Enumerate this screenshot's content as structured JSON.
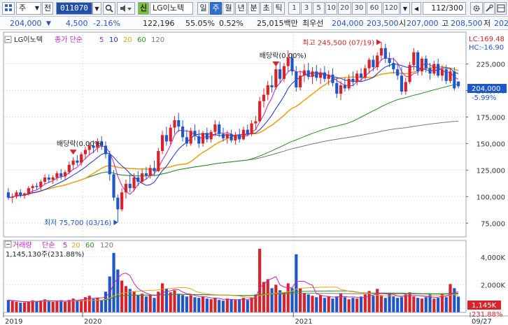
{
  "toolbar": {
    "market_label": "주",
    "period_label": "전",
    "stock_code": "011070",
    "badge": "신",
    "stock_name": "LG이노텍",
    "periods": [
      "일",
      "주",
      "월",
      "년",
      "분",
      "초",
      "틱"
    ],
    "active_period": "주",
    "intervals": [
      "1",
      "3",
      "5",
      "10",
      "20",
      "30",
      "60",
      "120"
    ],
    "count_display": "112/300"
  },
  "quote": {
    "price": "204,000",
    "change": "4,500",
    "change_pct": "-2.16%",
    "volume": "122,196",
    "volume_ratio": "55.05%",
    "turnover_ratio": "0.52%",
    "trade_value": "25,015백만",
    "bid_label": "최우선",
    "bid1": "204,000",
    "bid2": "203,500",
    "high_label": "시",
    "open": "207,000",
    "high_label2": "고",
    "high": "208,500",
    "low_label": "저",
    "low": "202"
  },
  "colors": {
    "up": "#d8232a",
    "down": "#1f57c8",
    "ma5": "#c021c0",
    "ma10": "#1b2fd0",
    "ma20": "#e8a317",
    "ma60": "#2a8f2a",
    "ma120": "#777777"
  },
  "chart_data": {
    "type": "candlestick",
    "price_legend": {
      "name": "LG이노텍",
      "label": "종가 단순",
      "periods": [
        "5",
        "10",
        "20",
        "60",
        "120"
      ]
    },
    "volume_legend": {
      "name": "거래량",
      "label": "단순",
      "periods": [
        "5",
        "20",
        "60",
        "120"
      ],
      "current": "1,145,130주(231.88%)"
    },
    "price_axis": {
      "ticks": [
        75000,
        100000,
        125000,
        150000,
        175000,
        200000,
        225000
      ],
      "tick_labels": [
        "75,000",
        "100,000",
        "125,000",
        "150,000",
        "175,000",
        "200,000",
        "225,000"
      ],
      "range": [
        62000,
        255000
      ]
    },
    "volume_axis": {
      "ticks": [
        2000,
        4000
      ],
      "tick_labels": [
        "2,000K",
        "4,000K"
      ],
      "range": [
        0,
        5200
      ]
    },
    "x_labels": [
      {
        "label": "2019",
        "index": 0
      },
      {
        "label": "2020",
        "index": 19
      },
      {
        "label": "2021",
        "index": 71
      },
      {
        "label": "09/27",
        "index": 111
      }
    ],
    "candles": [
      [
        104000,
        108000,
        97000,
        99000
      ],
      [
        99000,
        103000,
        94000,
        100000
      ],
      [
        100000,
        106000,
        98000,
        104000
      ],
      [
        104000,
        107000,
        99000,
        101000
      ],
      [
        101000,
        104000,
        98000,
        103000
      ],
      [
        103000,
        110000,
        101000,
        108000
      ],
      [
        108000,
        112000,
        104000,
        110000
      ],
      [
        110000,
        113000,
        106000,
        109000
      ],
      [
        109000,
        116000,
        106000,
        114000
      ],
      [
        114000,
        121000,
        111000,
        118000
      ],
      [
        118000,
        121000,
        113000,
        116000
      ],
      [
        116000,
        120000,
        112000,
        118000
      ],
      [
        118000,
        124000,
        115000,
        122000
      ],
      [
        122000,
        126000,
        116000,
        119000
      ],
      [
        119000,
        125000,
        116000,
        123000
      ],
      [
        123000,
        133000,
        121000,
        130000
      ],
      [
        130000,
        137000,
        126000,
        134000
      ],
      [
        134000,
        139000,
        129000,
        132000
      ],
      [
        132000,
        142000,
        129000,
        140000
      ],
      [
        140000,
        147000,
        135000,
        144000
      ],
      [
        144000,
        151000,
        139000,
        148000
      ],
      [
        148000,
        153000,
        141000,
        146000
      ],
      [
        146000,
        155000,
        142000,
        152000
      ],
      [
        152000,
        157000,
        144000,
        148000
      ],
      [
        148000,
        152000,
        136000,
        140000
      ],
      [
        140000,
        143000,
        115000,
        121000
      ],
      [
        121000,
        125000,
        96000,
        99000
      ],
      [
        99000,
        102000,
        75700,
        88000
      ],
      [
        88000,
        108000,
        86000,
        104000
      ],
      [
        104000,
        116000,
        98000,
        112000
      ],
      [
        112000,
        121000,
        104000,
        108000
      ],
      [
        108000,
        122000,
        105000,
        118000
      ],
      [
        118000,
        124000,
        110000,
        114000
      ],
      [
        114000,
        126000,
        112000,
        122000
      ],
      [
        122000,
        128000,
        116000,
        120000
      ],
      [
        120000,
        130000,
        117000,
        127000
      ],
      [
        127000,
        134000,
        120000,
        124000
      ],
      [
        124000,
        146000,
        123000,
        143000
      ],
      [
        143000,
        162000,
        140000,
        158000
      ],
      [
        158000,
        166000,
        148000,
        152000
      ],
      [
        152000,
        168000,
        149000,
        165000
      ],
      [
        165000,
        176000,
        159000,
        172000
      ],
      [
        172000,
        179000,
        161000,
        166000
      ],
      [
        166000,
        172000,
        152000,
        156000
      ],
      [
        156000,
        163000,
        147000,
        150000
      ],
      [
        150000,
        165000,
        148000,
        162000
      ],
      [
        162000,
        168000,
        153000,
        157000
      ],
      [
        157000,
        163000,
        146000,
        150000
      ],
      [
        150000,
        162000,
        147000,
        160000
      ],
      [
        160000,
        165000,
        151000,
        154000
      ],
      [
        154000,
        163000,
        151000,
        161000
      ],
      [
        161000,
        172000,
        157000,
        168000
      ],
      [
        168000,
        171000,
        156000,
        159000
      ],
      [
        159000,
        165000,
        152000,
        155000
      ],
      [
        155000,
        162000,
        150000,
        159000
      ],
      [
        159000,
        163000,
        151000,
        153000
      ],
      [
        153000,
        161000,
        149000,
        158000
      ],
      [
        158000,
        164000,
        151000,
        154000
      ],
      [
        154000,
        166000,
        153000,
        163000
      ],
      [
        163000,
        168000,
        157000,
        159000
      ],
      [
        159000,
        172000,
        157000,
        169000
      ],
      [
        169000,
        176000,
        163000,
        171000
      ],
      [
        171000,
        194000,
        170000,
        190000
      ],
      [
        190000,
        202000,
        184000,
        196000
      ],
      [
        196000,
        209000,
        191000,
        205000
      ],
      [
        205000,
        214000,
        198000,
        203000
      ],
      [
        203000,
        224000,
        201000,
        220000
      ],
      [
        220000,
        227000,
        207000,
        211000
      ],
      [
        211000,
        226000,
        208000,
        223000
      ],
      [
        223000,
        238000,
        218000,
        231000
      ],
      [
        231000,
        235000,
        214000,
        218000
      ],
      [
        218000,
        223000,
        199000,
        203000
      ],
      [
        203000,
        219000,
        200000,
        214000
      ],
      [
        214000,
        225000,
        208000,
        219000
      ],
      [
        219000,
        226000,
        210000,
        213000
      ],
      [
        213000,
        222000,
        206000,
        218000
      ],
      [
        218000,
        224000,
        209000,
        212000
      ],
      [
        212000,
        221000,
        206000,
        217000
      ],
      [
        217000,
        223000,
        208000,
        211000
      ],
      [
        211000,
        219000,
        205000,
        215000
      ],
      [
        215000,
        221000,
        204000,
        207000
      ],
      [
        207000,
        212000,
        193000,
        197000
      ],
      [
        197000,
        209000,
        191000,
        205000
      ],
      [
        205000,
        212000,
        199000,
        202000
      ],
      [
        202000,
        215000,
        200000,
        211000
      ],
      [
        211000,
        218000,
        204000,
        208000
      ],
      [
        208000,
        219000,
        205000,
        216000
      ],
      [
        216000,
        221000,
        208000,
        212000
      ],
      [
        212000,
        224000,
        210000,
        221000
      ],
      [
        221000,
        231000,
        216000,
        229000
      ],
      [
        229000,
        233000,
        218000,
        222000
      ],
      [
        222000,
        236000,
        219000,
        233000
      ],
      [
        233000,
        245500,
        228000,
        240000
      ],
      [
        240000,
        244000,
        226000,
        230000
      ],
      [
        230000,
        236000,
        222000,
        226000
      ],
      [
        226000,
        231000,
        216000,
        220000
      ],
      [
        220000,
        226000,
        210000,
        214000
      ],
      [
        214000,
        222000,
        196000,
        199000
      ],
      [
        199000,
        212000,
        196000,
        208000
      ],
      [
        208000,
        227000,
        206000,
        224000
      ],
      [
        224000,
        240000,
        219000,
        236000
      ],
      [
        236000,
        238000,
        214000,
        218000
      ],
      [
        218000,
        232000,
        214000,
        230000
      ],
      [
        230000,
        233000,
        217000,
        221000
      ],
      [
        221000,
        226000,
        210000,
        216000
      ],
      [
        216000,
        228000,
        214000,
        225000
      ],
      [
        225000,
        230000,
        212000,
        214000
      ],
      [
        214000,
        224000,
        209000,
        220000
      ],
      [
        220000,
        224000,
        206000,
        209000
      ],
      [
        209000,
        221000,
        207000,
        218000
      ],
      [
        218000,
        222000,
        200000,
        202000
      ],
      [
        208500,
        208500,
        202000,
        204000
      ]
    ],
    "volume": [
      900,
      820,
      760,
      700,
      720,
      780,
      880,
      820,
      860,
      940,
      800,
      760,
      820,
      880,
      760,
      900,
      1000,
      860,
      940,
      1100,
      1200,
      980,
      1050,
      900,
      1500,
      2600,
      4300,
      3100,
      2300,
      1900,
      1700,
      1500,
      1250,
      1350,
      1150,
      1250,
      1050,
      1500,
      2100,
      1700,
      1450,
      1600,
      1350,
      1250,
      1150,
      1250,
      1100,
      1050,
      1150,
      1000,
      950,
      1050,
      900,
      850,
      1000,
      950,
      900,
      950,
      1050,
      900,
      1100,
      1300,
      4600,
      2200,
      2400,
      1750,
      2000,
      1600,
      1450,
      2100,
      1750,
      4200,
      1750,
      1400,
      1300,
      1200,
      1100,
      1250,
      1050,
      1150,
      1000,
      1150,
      1350,
      1100,
      950,
      1050,
      1000,
      1150,
      1300,
      1550,
      1200,
      1700,
      1250,
      1050,
      1400,
      1150,
      1050,
      1100,
      1300,
      1450,
      1150,
      1050,
      1000,
      1100,
      1300,
      1000,
      1050,
      1350,
      1100,
      2050,
      1750,
      1145
    ],
    "annotations": [
      {
        "text": "최고 245,500 (07/19)",
        "index": 92,
        "price": 245500,
        "kind": "high"
      },
      {
        "text": "최저 75,700 (03/16)",
        "index": 27,
        "price": 75700,
        "kind": "low"
      },
      {
        "text": "배당락(0.00%)",
        "index": 16,
        "price": 141000,
        "kind": "dividend"
      },
      {
        "text": "배당락(0.00%)",
        "index": 66,
        "price": 224000,
        "kind": "dividend"
      }
    ],
    "right_labels": {
      "lc": "LC:169.48",
      "hc": "HC:-16.90",
      "last_price": "204,000",
      "last_change": "-5.99%",
      "last_volume": "1,145K",
      "last_volume_ratio": "231.88%"
    }
  }
}
